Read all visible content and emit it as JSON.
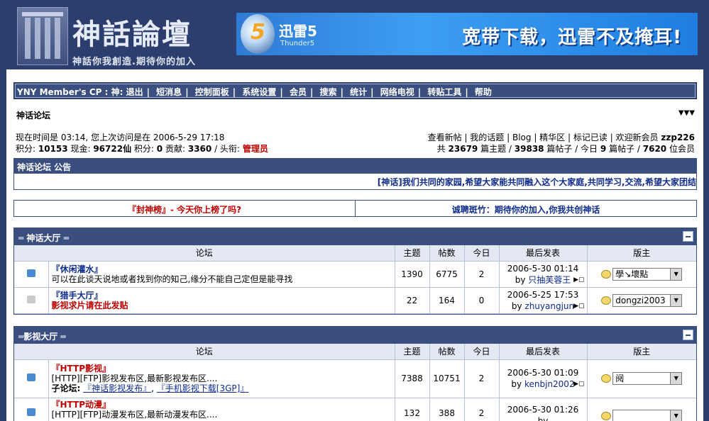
{
  "header": {
    "logo_title": "神話論壇",
    "logo_sub": "神話你我創造.期待你的加入",
    "banner": {
      "brand": "迅雷5",
      "brand_sub": "Thunder5",
      "slogan": "宽带下载，迅雷不及掩耳!"
    }
  },
  "topbar": {
    "prefix": "YNY Member's CP : 神:",
    "links": [
      "退出",
      "短消息",
      "控制面板",
      "系统设置",
      "会员",
      "搜索",
      "统计",
      "网络电视",
      "转贴工具",
      "帮助"
    ]
  },
  "breadcrumb": "神话论坛",
  "info": {
    "time_label": "现在时间是",
    "time_value": "03:14,",
    "last_visit_label": "您上次访问是在",
    "last_visit_value": "2006-5-29 17:18",
    "points_label": "积分:",
    "points_value": "10153",
    "cash_label": "现金:",
    "cash_value": "96722仙",
    "score_label": "积分:",
    "score_value": "0",
    "contrib_label": "贡献:",
    "contrib_value": "3360",
    "title_label": "/ 头衔:",
    "title_value": "管理员",
    "links": [
      "查看新帖",
      "我的话题",
      "Blog",
      "精华区",
      "标记已读",
      "欢迎新会员"
    ],
    "new_member": "zzp226",
    "stats_line": {
      "p1": "共",
      "topics": "23679",
      "p2": "篇主题 /",
      "posts": "39838",
      "p3": "篇帖子 / 今日",
      "today": "9",
      "p4": "篇帖子 /",
      "members": "7620",
      "p5": "位会员"
    }
  },
  "announce": {
    "title": "神话论坛 公告",
    "text": "[神话]我们共同的家园,希望大家能共同融入这个大家庭,共同学习,交流,希望大家团结"
  },
  "promo": {
    "left": "『封神榜』- 今天你上榜了吗?",
    "right": "诚聘斑竹：期待你的加入,你我共创神话"
  },
  "columns": {
    "forum": "论坛",
    "topics": "主题",
    "posts": "帖数",
    "today": "今日",
    "last_post": "最后发表",
    "moderator": "版主"
  },
  "categories": [
    {
      "title": "神话大厅",
      "forums": [
        {
          "name": "『休闲灌水』",
          "desc": "可以在此谈天说地或者找到你的知己,缘分不能自己定但是能寻找",
          "topics": "1390",
          "posts": "6775",
          "today": "2",
          "last_date": "2006-5-30 01:14",
          "last_by_prefix": "by",
          "last_by": "只抽芙蓉王",
          "moderator": "學↘壞點"
        },
        {
          "name": "『猎手大厅』",
          "desc": "影视求片请在此发贴",
          "topics": "22",
          "posts": "164",
          "today": "0",
          "last_date": "2006-5-25 17:53",
          "last_by_prefix": "by",
          "last_by": "zhuyangjun",
          "moderator": "dongzi2003"
        }
      ]
    },
    {
      "title": "影视大厅",
      "forums": [
        {
          "name": "『HTTP影视』",
          "desc": "[HTTP][FTP]影视发布区,最新影视发布区....",
          "sub_label": "子论坛:",
          "subs": [
            "『神话影视发布』",
            "『手机影视下载[3GP]』"
          ],
          "topics": "7388",
          "posts": "10751",
          "today": "2",
          "last_date": "2006-5-30 01:09",
          "last_by_prefix": "by",
          "last_by": "kenbjn2002",
          "moderator": "阋"
        },
        {
          "name": "『HTTP动漫』",
          "desc": "[HTTP][FTP]动漫发布区,最新动漫发布区....",
          "topics": "132",
          "posts": "388",
          "today": "2",
          "last_date": "2006-5-30 01:26",
          "last_by_prefix": "by",
          "last_by": "",
          "moderator": ""
        }
      ]
    }
  ]
}
